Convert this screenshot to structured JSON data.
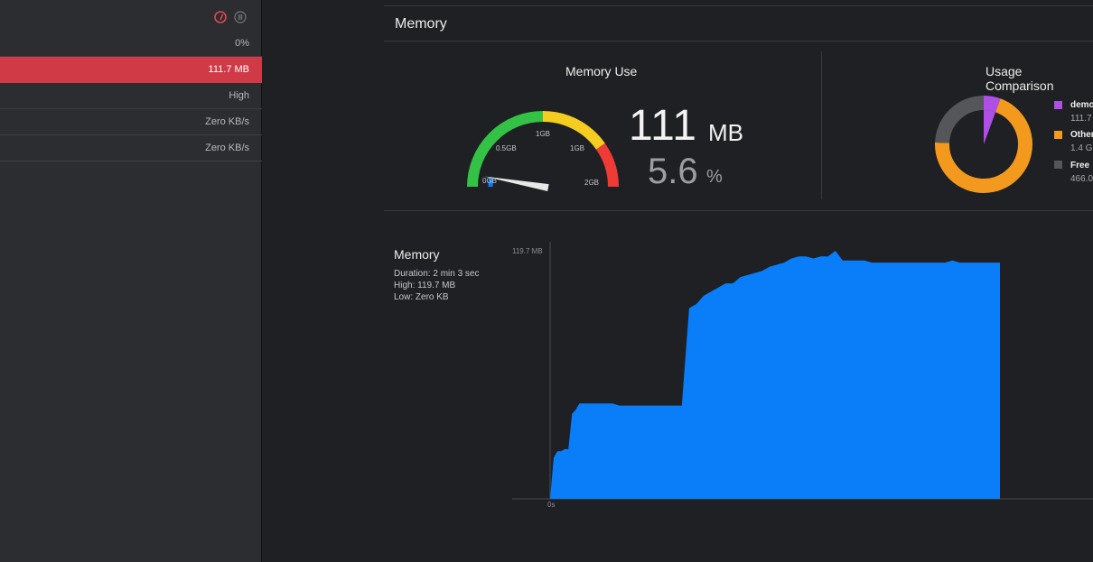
{
  "sidebar": {
    "rows": [
      {
        "value": "0%"
      },
      {
        "value": "111.7 MB",
        "selected": true
      },
      {
        "value": "High"
      },
      {
        "value": "Zero KB/s"
      },
      {
        "value": "Zero KB/s"
      }
    ],
    "icons": [
      "gauge-icon",
      "pause-icon"
    ]
  },
  "memory_panel": {
    "title": "Memory",
    "memory_use": {
      "heading": "Memory Use",
      "value": "111",
      "unit": "MB",
      "percent": "5.6",
      "percent_unit": "%",
      "gauge_fraction": 0.056,
      "gauge_labels": {
        "zero": "0GB",
        "half": "0.5GB",
        "one_a": "1GB",
        "one_b": "1GB",
        "two": "2GB"
      }
    },
    "usage_comparison": {
      "heading": "Usage Comparison",
      "slices": [
        {
          "name": "demo",
          "value": "111.7",
          "fraction": 0.056,
          "color": "#b04fe6"
        },
        {
          "name": "Other",
          "value": "1.4 G",
          "fraction": 0.7,
          "color": "#f39a1e"
        },
        {
          "name": "Free",
          "value": "466.0",
          "fraction": 0.244,
          "color": "#55565a"
        }
      ]
    },
    "graph": {
      "title": "Memory",
      "duration": "Duration: 2 min 3 sec",
      "high": "High: 119.7 MB",
      "low": "Low: Zero KB",
      "y_max_label": "119.7 MB",
      "x_start_label": "0s",
      "color": "#0a7df9"
    }
  },
  "chart_data": {
    "type": "area",
    "title": "Memory",
    "xlabel": "",
    "ylabel": "",
    "ylim": [
      0,
      119.7
    ],
    "x": [
      0,
      1,
      2,
      3,
      4,
      5,
      6,
      7,
      8,
      9,
      11,
      13,
      15,
      17,
      19,
      21,
      23,
      25,
      27,
      29,
      30,
      31,
      32,
      33,
      34,
      35,
      36,
      38,
      40,
      42,
      44,
      46,
      48,
      50,
      52,
      54,
      56,
      58,
      60,
      62,
      64,
      66,
      68,
      70,
      72,
      74,
      76,
      78,
      80,
      82,
      84,
      86,
      88,
      90,
      92,
      94,
      96,
      98,
      100,
      102,
      104,
      106,
      108,
      110,
      112,
      114,
      116,
      118,
      120,
      122,
      123
    ],
    "series": [
      {
        "values": [
          0,
          20,
          23,
          23,
          24,
          24,
          41,
          43,
          46,
          46,
          46,
          46,
          46,
          46,
          45,
          45,
          45,
          45,
          45,
          45,
          45,
          45,
          45,
          45,
          45,
          45,
          45,
          92,
          94,
          98,
          100,
          102,
          104,
          104,
          107,
          108,
          109,
          110,
          112,
          113,
          114,
          116,
          117,
          117,
          116,
          117,
          117,
          119.7,
          115,
          115,
          115,
          115,
          114,
          114,
          114,
          114,
          114,
          114,
          114,
          114,
          114,
          114,
          114,
          115,
          114,
          114,
          114,
          114,
          114,
          114,
          114
        ]
      }
    ]
  }
}
